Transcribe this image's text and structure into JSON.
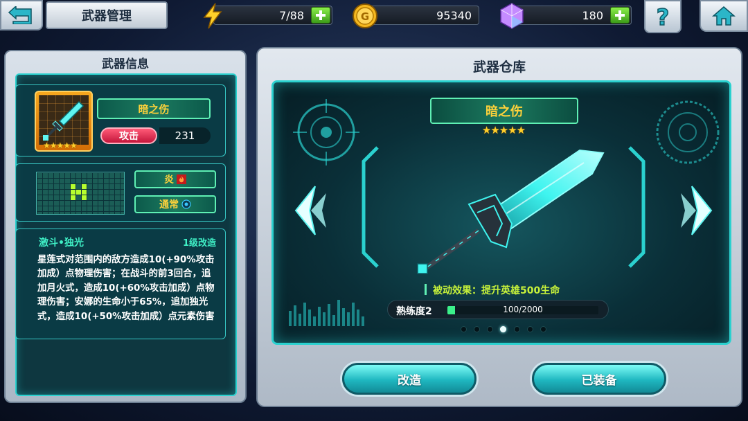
{
  "header": {
    "title": "武器管理",
    "energy": "7/88",
    "gold": "95340",
    "gems": "180"
  },
  "info_panel": {
    "title": "武器信息",
    "weapon_name": "暗之伤",
    "stars": "★★★★★",
    "attack_label": "攻击",
    "attack_value": "231",
    "element_label": "炎",
    "attack_type_label": "通常",
    "skill_name": "激斗•独光",
    "skill_level": "1级改造",
    "skill_description": "星莲式对范围内的敌方造成10(+90%攻击加成）点物理伤害；在战斗的前3回合，追加月火式，造成10(+60%攻击加成）点物理伤害；安娜的生命小于65%，追加独光式，造成10(+50%攻击加成）点元素伤害"
  },
  "warehouse": {
    "title": "武器仓库",
    "weapon_name": "暗之伤",
    "stars": "★★★★★",
    "passive_effect": "被动效果：提升英雄500生命",
    "proficiency_label": "熟练度2",
    "proficiency_value": "100/2000",
    "proficiency_fraction": 0.05,
    "page_count": 7,
    "active_page": 4,
    "modify_button": "改造",
    "equipped_button": "已装备"
  },
  "colors": {
    "accent_cyan": "#2bd1cf",
    "name_gold": "#ffd23a",
    "attack_red": "#e0244a",
    "plus_green": "#5ccb2a",
    "progress_green": "#3bf08a"
  },
  "icons": {
    "back": "back-arrow-icon",
    "energy": "lightning-icon",
    "gold": "gold-coin-icon",
    "gem": "gem-icon",
    "help": "question-icon",
    "home": "home-icon",
    "fire": "fire-icon",
    "target": "target-icon"
  }
}
